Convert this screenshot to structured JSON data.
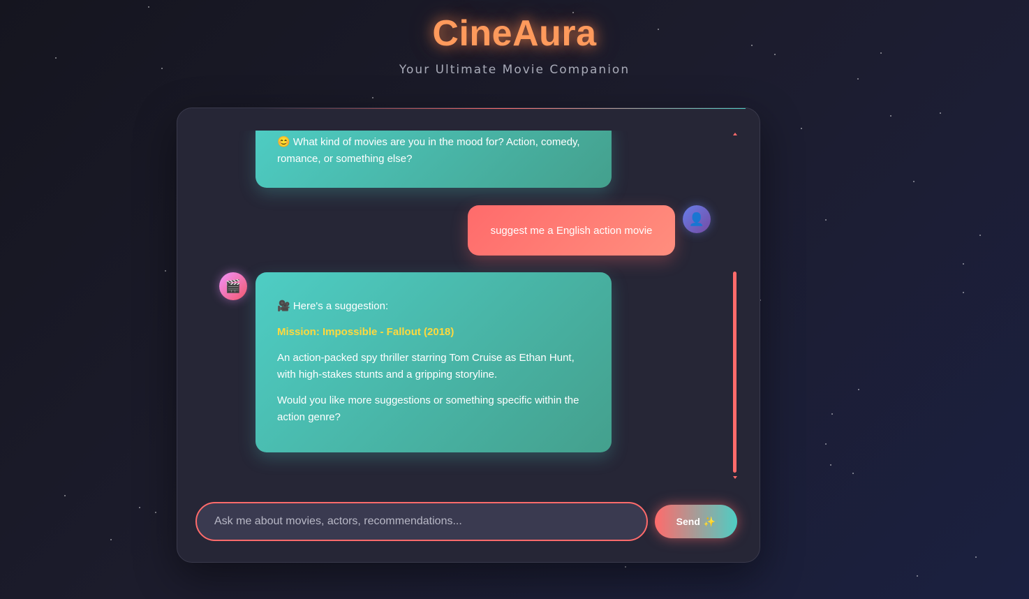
{
  "app": {
    "title": "CineAura",
    "tagline": "Your Ultimate Movie Companion"
  },
  "messages": [
    {
      "role": "bot",
      "text": "😊 What kind of movies are you in the mood for? Action, comedy, romance, or something else?"
    },
    {
      "role": "user",
      "text": "suggest me a English action movie"
    },
    {
      "role": "bot",
      "intro": "🎥 Here's a suggestion:",
      "movie_title": "Mission: Impossible - Fallout (2018)",
      "description": "An action-packed spy thriller starring Tom Cruise as Ethan Hunt, with high-stakes stunts and a gripping storyline.",
      "followup": "Would you like more suggestions or something specific within the action genre?"
    }
  ],
  "avatars": {
    "bot_icon": "🎬",
    "user_icon": "👤"
  },
  "input": {
    "placeholder": "Ask me about movies, actors, recommendations...",
    "value": ""
  },
  "send_button": {
    "label": "Send",
    "icon": "✨"
  },
  "colors": {
    "accent_coral": "#ff6b6b",
    "accent_teal": "#4ecdc4",
    "logo_orange": "#ff9a5c",
    "movie_title_yellow": "#ffd93d"
  }
}
